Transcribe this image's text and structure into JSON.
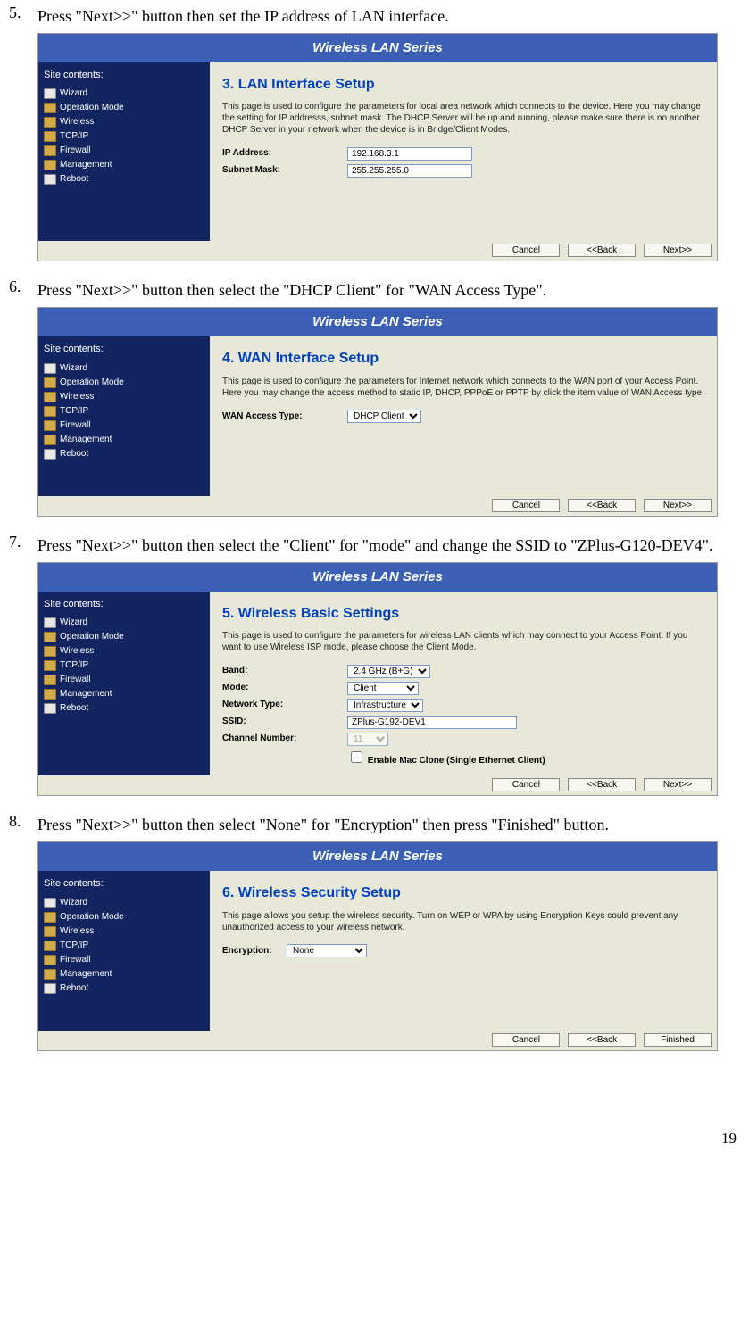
{
  "steps": {
    "s5": {
      "num": "5.",
      "text": "Press \"Next>>\" button then set the IP address of LAN interface."
    },
    "s6": {
      "num": "6.",
      "text": "Press \"Next>>\" button then select the \"DHCP Client\" for \"WAN Access Type\"."
    },
    "s7": {
      "num": "7.",
      "text": "Press \"Next>>\" button then select the \"Client\" for \"mode\" and change the SSID to \"ZPlus-G120-DEV4\"."
    },
    "s8": {
      "num": "8.",
      "text": "Press \"Next>>\" button then select \"None\" for \"Encryption\" then press \"Finished\" button."
    }
  },
  "common": {
    "banner": "Wireless LAN Series",
    "sidebar_title": "Site contents:",
    "menu": {
      "wizard": "Wizard",
      "opmode": "Operation Mode",
      "wireless": "Wireless",
      "tcpip": "TCP/IP",
      "firewall": "Firewall",
      "management": "Management",
      "reboot": "Reboot"
    },
    "buttons": {
      "cancel": "Cancel",
      "back": "<<Back",
      "next": "Next>>",
      "finished": "Finished"
    }
  },
  "panel3": {
    "heading": "3. LAN Interface Setup",
    "desc": "This page is used to configure the parameters for local area network which connects to the device. Here you may change the setting for IP addresss, subnet mask. The DHCP Server will be up and running, please make sure there is no another DHCP Server in your network when the device is in Bridge/Client Modes.",
    "ip_label": "IP Address:",
    "ip_value": "192.168.3.1",
    "mask_label": "Subnet Mask:",
    "mask_value": "255.255.255.0"
  },
  "panel4": {
    "heading": "4. WAN Interface Setup",
    "desc": "This page is used to configure the parameters for Internet network which connects to the WAN port of your Access Point. Here you may change the access method to static IP, DHCP, PPPoE or PPTP by click the item value of WAN Access type.",
    "wan_label": "WAN Access Type:",
    "wan_value": "DHCP Client"
  },
  "panel5": {
    "heading": "5. Wireless Basic Settings",
    "desc": "This page is used to configure the parameters for wireless LAN clients which may connect to your Access Point. If you want to use Wireless ISP mode, please choose the Client Mode.",
    "band_label": "Band:",
    "band_value": "2.4 GHz (B+G)",
    "mode_label": "Mode:",
    "mode_value": "Client",
    "nettype_label": "Network Type:",
    "nettype_value": "Infrastructure",
    "ssid_label": "SSID:",
    "ssid_value": "ZPlus-G192-DEV1",
    "channel_label": "Channel Number:",
    "channel_value": "11",
    "mac_clone": "Enable Mac Clone (Single Ethernet Client)"
  },
  "panel6": {
    "heading": "6. Wireless Security Setup",
    "desc": "This page allows you setup the wireless security. Turn on WEP or WPA by using Encryption Keys could prevent any unauthorized access to your wireless network.",
    "enc_label": "Encryption:",
    "enc_value": "None"
  },
  "page_number": "19"
}
